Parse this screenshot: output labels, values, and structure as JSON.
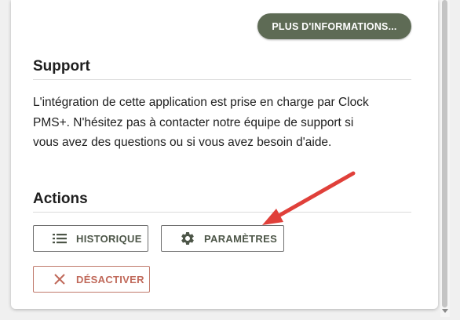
{
  "header": {
    "more_info_label": "PLUS D'INFORMATIONS..."
  },
  "support": {
    "title": "Support",
    "text_line_1": "L'intégration de cette application est prise en charge par Clock",
    "text_line_2": "PMS+. N'hésitez pas à contacter notre équipe de support si",
    "text_line_3": "vous avez des questions ou si vous avez besoin d'aide."
  },
  "actions": {
    "title": "Actions",
    "history_label": "HISTORIQUE",
    "history_icon": "list-icon",
    "settings_label": "PARAMÈTRES",
    "settings_icon": "gear-icon",
    "deactivate_label": "DÉSACTIVER",
    "deactivate_icon": "close-icon"
  },
  "colors": {
    "accent": "#5e6b55",
    "danger": "#c0695a",
    "annotation_arrow": "#e0403a"
  }
}
